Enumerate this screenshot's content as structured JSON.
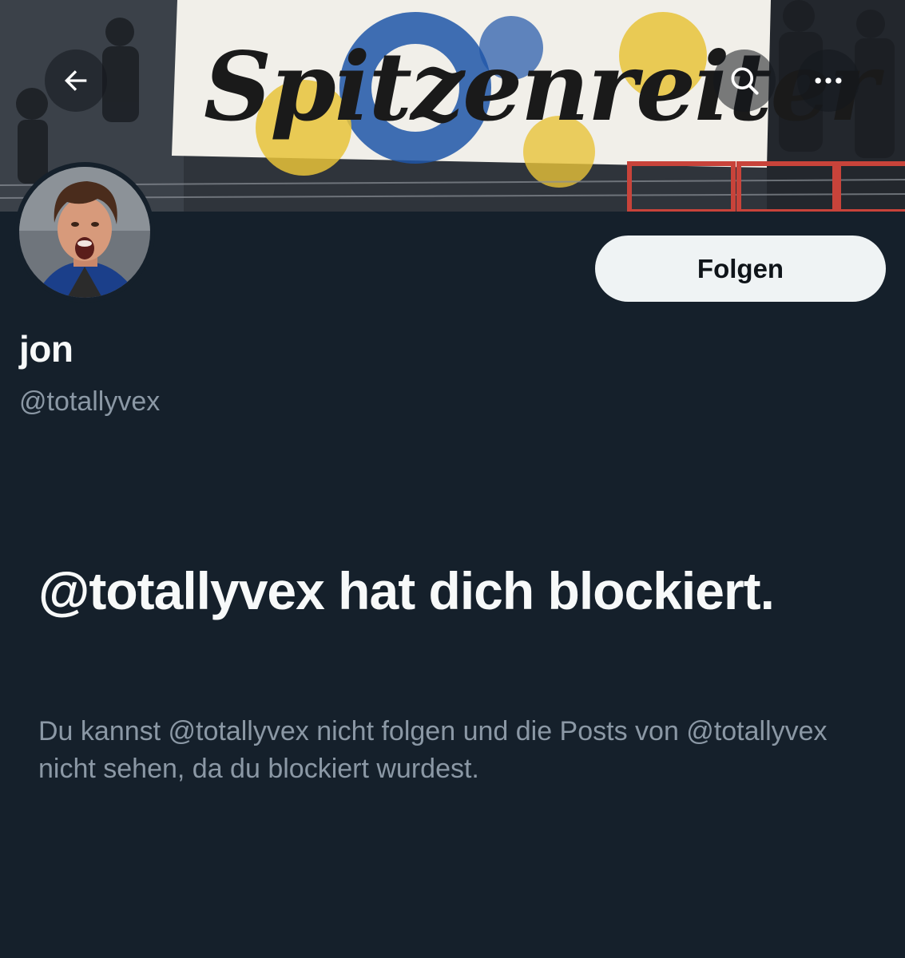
{
  "header": {
    "banner_text": "Spitzenreiter",
    "back_icon": "arrow-left-icon",
    "search_icon": "search-icon",
    "more_icon": "more-horizontal-icon"
  },
  "profile": {
    "display_name": "jon",
    "handle": "@totallyvex",
    "follow_label": "Folgen"
  },
  "blocked": {
    "title": "@totallyvex hat dich blockiert.",
    "description": "Du kannst @totallyvex nicht folgen und die Posts von @totallyvex nicht sehen, da du blockiert wurdest."
  },
  "colors": {
    "background": "#15202b",
    "primary_text": "#f7f9f9",
    "secondary_text": "#8b98a5",
    "follow_button_bg": "#eff3f4"
  }
}
